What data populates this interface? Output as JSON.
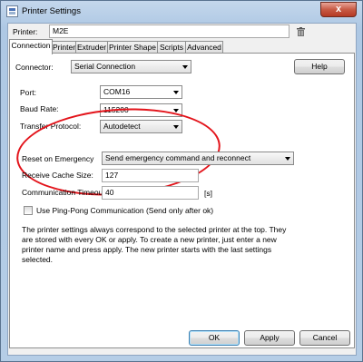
{
  "window": {
    "title": "Printer Settings",
    "close_glyph": "x"
  },
  "printer": {
    "label": "Printer:",
    "value": "M2E"
  },
  "tabs": [
    {
      "label": "Connection",
      "active": true
    },
    {
      "label": "Printer",
      "active": false
    },
    {
      "label": "Extruder",
      "active": false
    },
    {
      "label": "Printer Shape",
      "active": false
    },
    {
      "label": "Scripts",
      "active": false
    },
    {
      "label": "Advanced",
      "active": false
    }
  ],
  "connection": {
    "connector_label": "Connector:",
    "connector_value": "Serial Connection",
    "help_label": "Help",
    "port_label": "Port:",
    "port_value": "COM16",
    "baud_label": "Baud Rate:",
    "baud_value": "115200",
    "protocol_label": "Transfer Protocol:",
    "protocol_value": "Autodetect",
    "reset_label": "Reset on Emergency",
    "reset_value": "Send emergency command and reconnect",
    "cache_label": "Receive Cache Size:",
    "cache_value": "127",
    "timeout_label": "Communication Timeout:",
    "timeout_value": "40",
    "timeout_unit": "[s]",
    "pingpong_label": "Use Ping-Pong Communication (Send only after ok)",
    "pingpong_checked": false,
    "info_lines": [
      "The printer settings always correspond to the selected printer at the top.  They",
      "are stored with every OK or apply. To create a new printer, just enter a new",
      "printer name and press apply. The new printer starts with the last settings",
      "selected."
    ]
  },
  "buttons": {
    "ok": "OK",
    "apply": "Apply",
    "cancel": "Cancel"
  },
  "colors": {
    "annotation": "#e3141b",
    "title_gradient_top": "#c4d7ec",
    "close_button": "#c75a45"
  },
  "icons": {
    "app": "printer-settings-icon",
    "close": "close-icon",
    "delete": "trash-icon",
    "dropdown": "chevron-down-icon"
  }
}
